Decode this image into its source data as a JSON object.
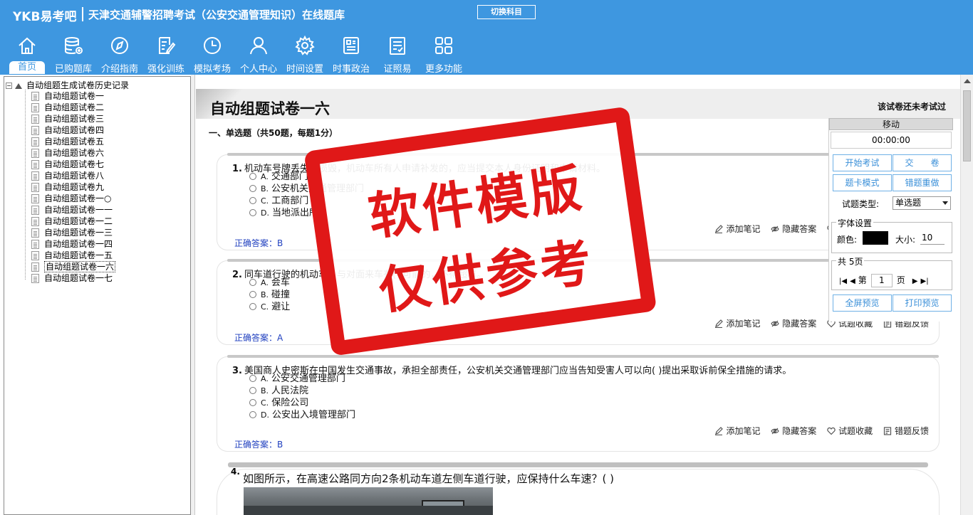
{
  "header": {
    "brand": "YKB易考吧",
    "exam_title": "天津交通辅警招聘考试（公安交通管理知识）在线题库",
    "switch_label": "切换科目"
  },
  "nav": [
    {
      "label": "首页",
      "icon": "home-icon"
    },
    {
      "label": "已购题库",
      "icon": "database-icon"
    },
    {
      "label": "介绍指南",
      "icon": "compass-icon"
    },
    {
      "label": "强化训练",
      "icon": "edit-icon"
    },
    {
      "label": "模拟考场",
      "icon": "clock-icon"
    },
    {
      "label": "个人中心",
      "icon": "user-icon"
    },
    {
      "label": "时间设置",
      "icon": "gear-icon"
    },
    {
      "label": "时事政治",
      "icon": "newspaper-icon"
    },
    {
      "label": "证照易",
      "icon": "checklist-icon"
    },
    {
      "label": "更多功能",
      "icon": "grid-icon"
    }
  ],
  "tree": {
    "root": "自动组题生成试卷历史记录",
    "items": [
      "自动组题试卷一",
      "自动组题试卷二",
      "自动组题试卷三",
      "自动组题试卷四",
      "自动组题试卷五",
      "自动组题试卷六",
      "自动组题试卷七",
      "自动组题试卷八",
      "自动组题试卷九",
      "自动组题试卷一○",
      "自动组题试卷一一",
      "自动组题试卷一二",
      "自动组题试卷一三",
      "自动组题试卷一四",
      "自动组题试卷一五",
      "自动组题试卷一六",
      "自动组题试卷一七"
    ],
    "selected": "自动组题试卷一六"
  },
  "paper": {
    "title": "自动组题试卷一六",
    "status": "该试卷还未考试过",
    "section": "一、单选题（共50题，每题1分）"
  },
  "questions": [
    {
      "number": "1.",
      "stem": "机动车号牌丢失、损毁，机动车所有人申请补发的，应当提交本人身份证明和申请材料。",
      "options": [
        [
          "A.",
          "交通部门"
        ],
        [
          "B.",
          "公安机关交通管理部门"
        ],
        [
          "C.",
          "工商部门"
        ],
        [
          "D.",
          "当地派出所"
        ]
      ],
      "answer": "正确答案：B"
    },
    {
      "number": "2.",
      "stem": "同车道行驶的机动车，与对面来车有(  )可能的，不得超车。",
      "options": [
        [
          "A.",
          "会车"
        ],
        [
          "B.",
          "碰撞"
        ],
        [
          "C.",
          "避让"
        ]
      ],
      "answer": "正确答案：A"
    },
    {
      "number": "3.",
      "stem": "美国商人史密斯在中国发生交通事故，承担全部责任，公安机关交通管理部门应当告知受害人可以向(  )提出采取诉前保全措施的请求。",
      "options": [
        [
          "A.",
          "公安交通管理部门"
        ],
        [
          "B.",
          "人民法院"
        ],
        [
          "C.",
          "保险公司"
        ],
        [
          "D.",
          "公安出入境管理部门"
        ]
      ],
      "answer": "正确答案：B"
    }
  ],
  "question4": {
    "number": "4.",
    "stem": "如图所示，在高速公路同方向2条机动车道左侧车道行驶，应保持什么车速？(   )"
  },
  "tools": {
    "note": "添加笔记",
    "hide": "隐藏答案",
    "fav": "试题收藏",
    "report": "错题反馈"
  },
  "panel": {
    "move": "移动",
    "timer": "00:00:00",
    "start": "开始考试",
    "submit": "交　　卷",
    "card_mode": "题卡模式",
    "redo_wrong": "错题重做",
    "type_label": "试题类型:",
    "type_value": "单选题",
    "font_legend": "字体设置",
    "color_label": "颜色:",
    "size_label": "大小:",
    "size_value": "10",
    "pages_legend": "共 5页",
    "page_prefix": "第",
    "page_value": "1",
    "page_suffix": "页",
    "fullscreen": "全屏预览",
    "print": "打印预览"
  },
  "stamp": {
    "line1": "软件模版",
    "line2": "仅供参考"
  },
  "colors": {
    "header_bg": "#3e97e0",
    "stamp_red": "#e01818",
    "answer_blue": "#1f3fbf"
  }
}
